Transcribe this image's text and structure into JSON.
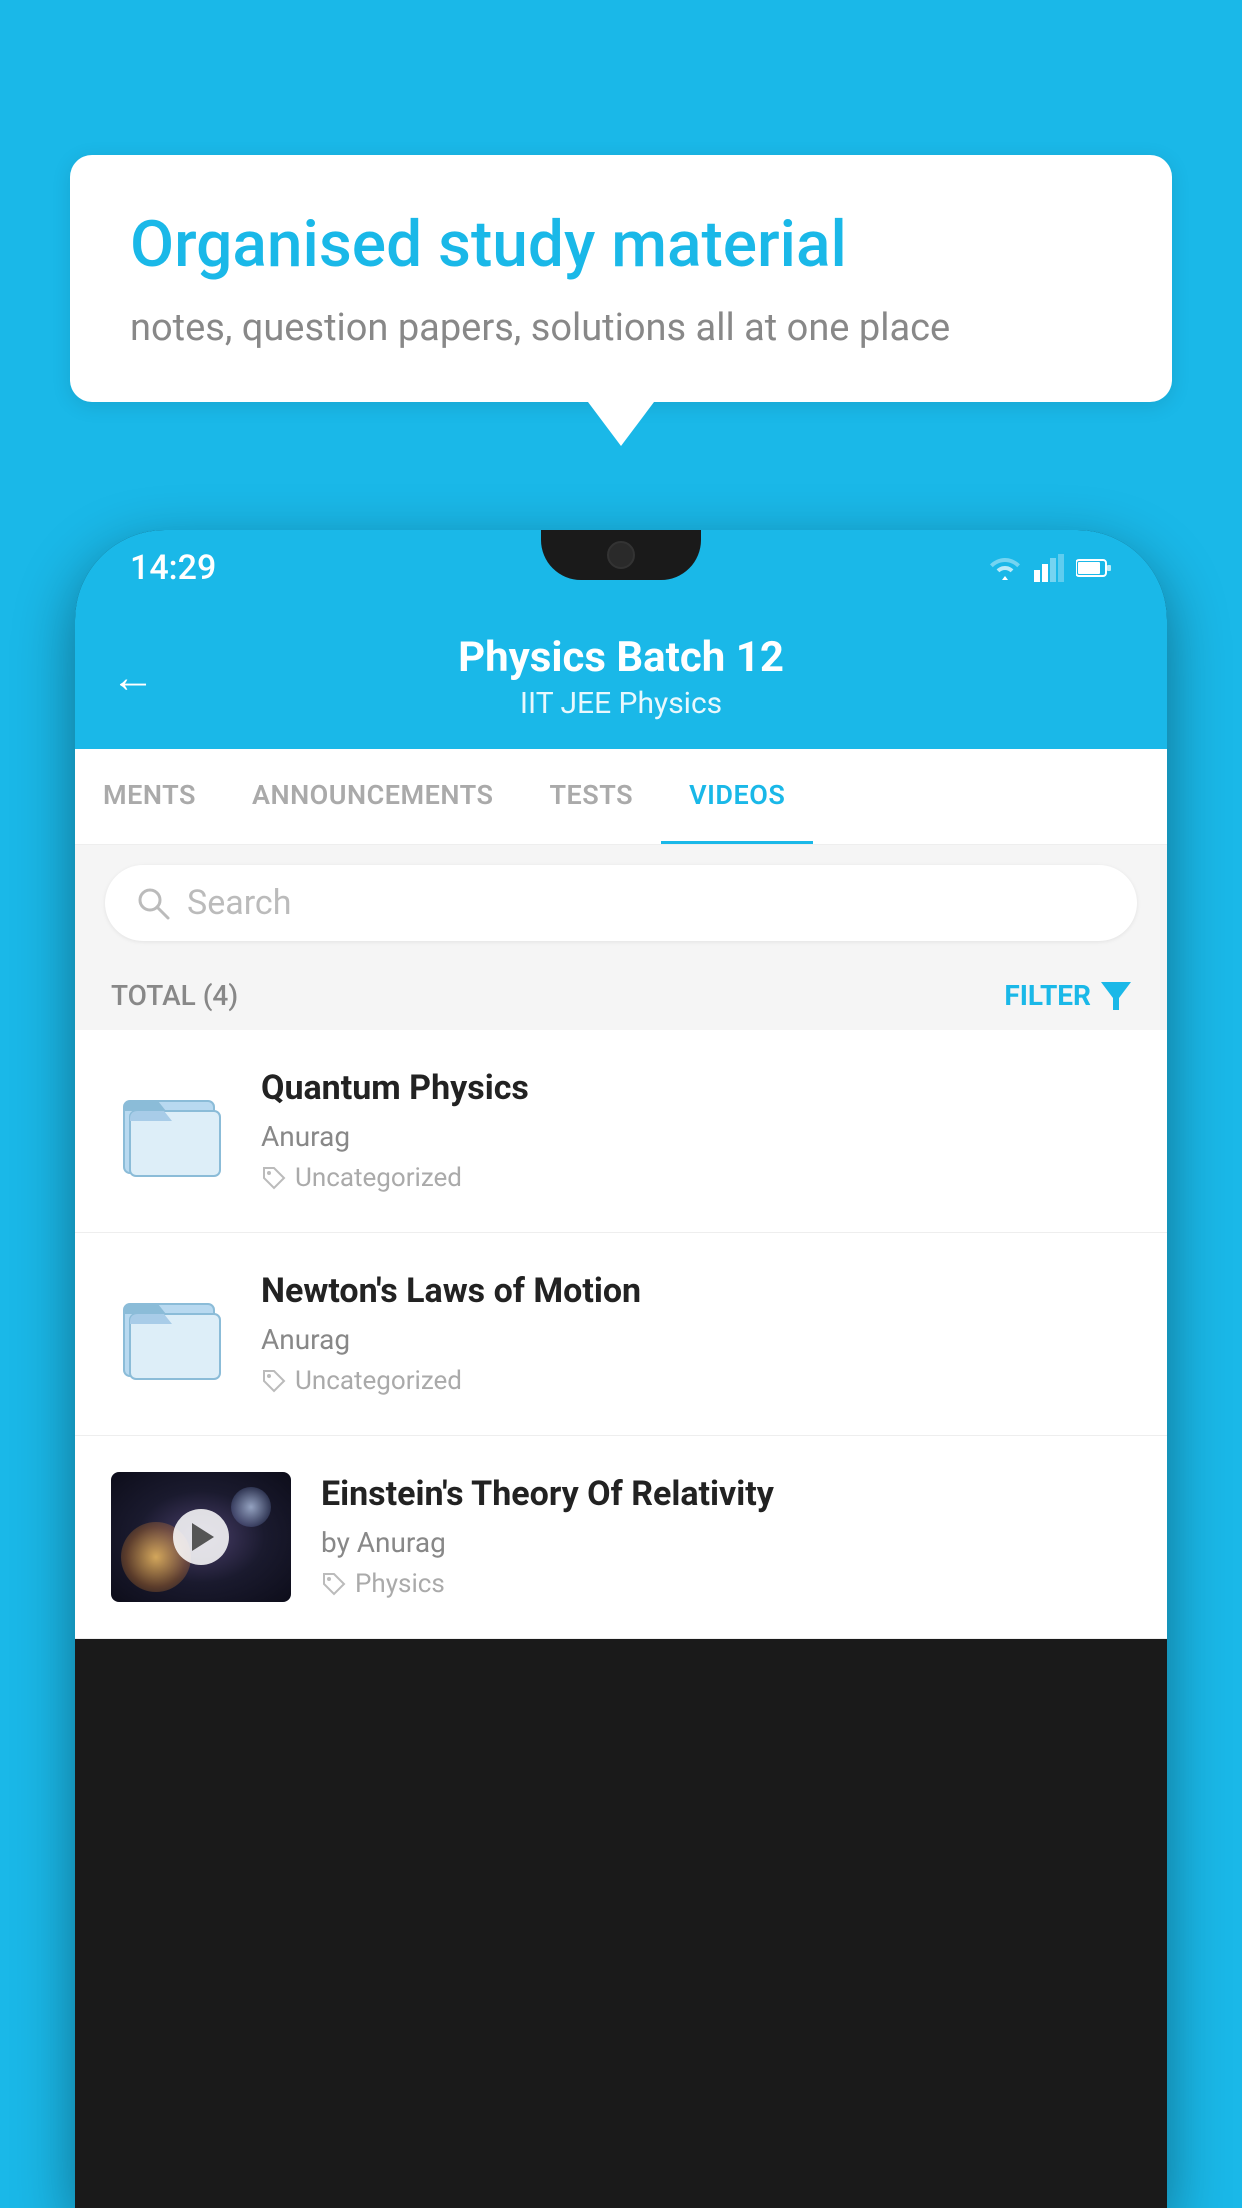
{
  "background_color": "#1ab8e8",
  "speech_bubble": {
    "title": "Organised study material",
    "subtitle": "notes, question papers, solutions all at one place"
  },
  "phone": {
    "status_bar": {
      "time": "14:29",
      "icons": [
        "wifi",
        "signal",
        "battery"
      ]
    },
    "header": {
      "back_label": "←",
      "title": "Physics Batch 12",
      "subtitle": "IIT JEE   Physics"
    },
    "tabs": [
      {
        "label": "MENTS",
        "active": false
      },
      {
        "label": "ANNOUNCEMENTS",
        "active": false
      },
      {
        "label": "TESTS",
        "active": false
      },
      {
        "label": "VIDEOS",
        "active": true
      }
    ],
    "search": {
      "placeholder": "Search"
    },
    "filter": {
      "total_label": "TOTAL (4)",
      "filter_label": "FILTER"
    },
    "videos": [
      {
        "id": 1,
        "title": "Quantum Physics",
        "author": "Anurag",
        "tag": "Uncategorized",
        "type": "folder",
        "has_thumbnail": false
      },
      {
        "id": 2,
        "title": "Newton's Laws of Motion",
        "author": "Anurag",
        "tag": "Uncategorized",
        "type": "folder",
        "has_thumbnail": false
      },
      {
        "id": 3,
        "title": "Einstein's Theory Of Relativity",
        "author": "by Anurag",
        "tag": "Physics",
        "type": "video",
        "has_thumbnail": true
      }
    ]
  }
}
